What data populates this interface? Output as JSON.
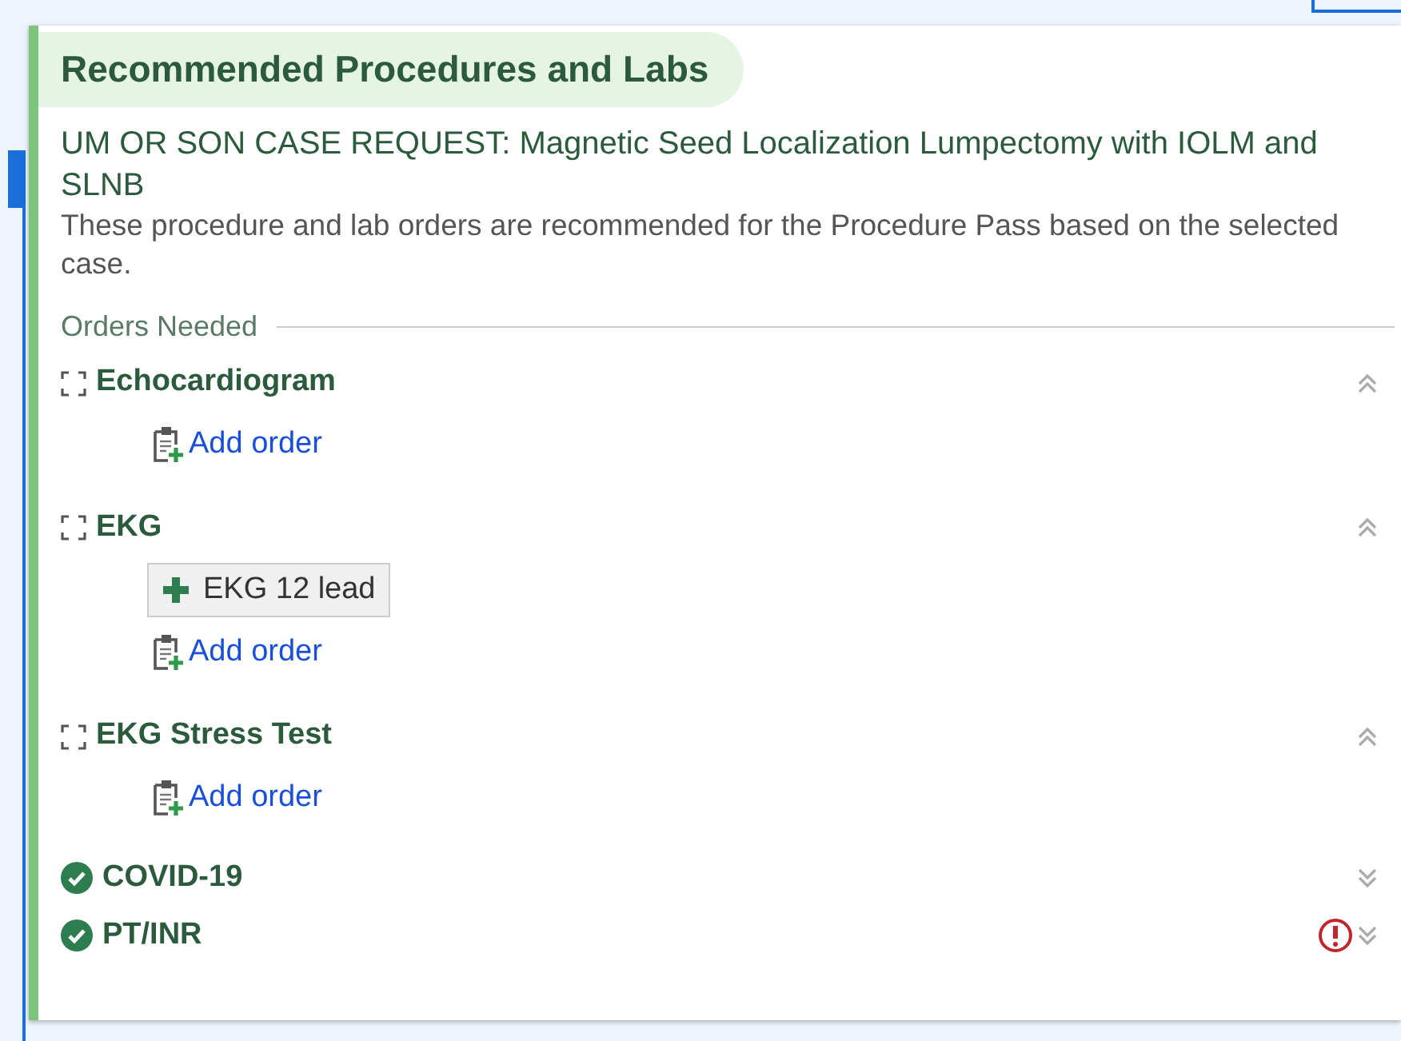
{
  "panel": {
    "title": "Recommended Procedures and Labs",
    "case_request": "UM OR SON CASE REQUEST: Magnetic Seed Localization Lumpectomy with IOLM and SLNB",
    "description": "These procedure and lab orders are recommended for the Procedure Pass based on the selected case.",
    "section_label": "Orders Needed",
    "items": [
      {
        "name": "Echocardiogram",
        "kind": "needed",
        "expanded": true,
        "alert": false,
        "add_label": "Add order"
      },
      {
        "name": "EKG",
        "kind": "needed",
        "expanded": true,
        "alert": false,
        "orders": [
          "EKG 12 lead"
        ],
        "add_label": "Add order"
      },
      {
        "name": "EKG Stress Test",
        "kind": "needed",
        "expanded": true,
        "alert": false,
        "add_label": "Add order"
      },
      {
        "name": "COVID-19",
        "kind": "done",
        "expanded": false,
        "alert": false
      },
      {
        "name": "PT/INR",
        "kind": "done",
        "expanded": false,
        "alert": true
      }
    ]
  }
}
